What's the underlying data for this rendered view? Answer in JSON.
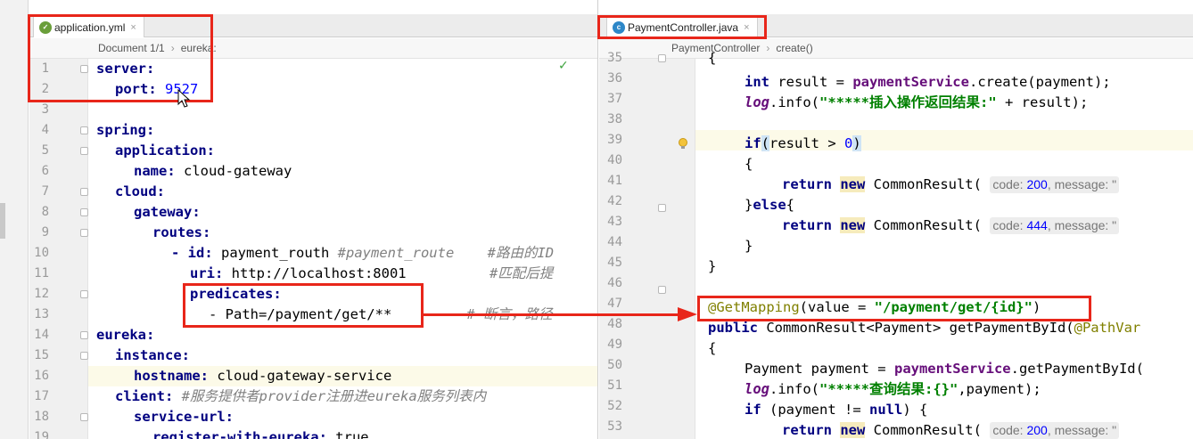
{
  "left_editor": {
    "tab_label": "application.yml",
    "tab_icon": "yaml-file-icon",
    "breadcrumb": [
      "Document 1/1",
      "eureka:"
    ],
    "lines": [
      {
        "n": "1",
        "indent": 0,
        "key": "server:",
        "val": "",
        "comment": ""
      },
      {
        "n": "2",
        "indent": 1,
        "key": "port:",
        "val": " 9527",
        "comment": ""
      },
      {
        "n": "3",
        "indent": 0,
        "key": "",
        "val": "",
        "comment": ""
      },
      {
        "n": "4",
        "indent": 0,
        "key": "spring:",
        "val": "",
        "comment": ""
      },
      {
        "n": "5",
        "indent": 1,
        "key": "application:",
        "val": "",
        "comment": ""
      },
      {
        "n": "6",
        "indent": 2,
        "key": "name:",
        "val": " cloud-gateway",
        "comment": ""
      },
      {
        "n": "7",
        "indent": 1,
        "key": "cloud:",
        "val": "",
        "comment": ""
      },
      {
        "n": "8",
        "indent": 2,
        "key": "gateway:",
        "val": "",
        "comment": ""
      },
      {
        "n": "9",
        "indent": 3,
        "key": "routes:",
        "val": "",
        "comment": ""
      },
      {
        "n": "10",
        "indent": 4,
        "key": "- id:",
        "val": " payment_routh ",
        "comment": "#payment_route    #路由的ID"
      },
      {
        "n": "11",
        "indent": 5,
        "key": "uri:",
        "val": " http://localhost:8001          ",
        "comment": "#匹配后提"
      },
      {
        "n": "12",
        "indent": 5,
        "key": "predicates:",
        "val": "",
        "comment": ""
      },
      {
        "n": "13",
        "indent": 6,
        "key": "",
        "val": "- Path=/payment/get/**",
        "comment": "         # 断言，路径"
      },
      {
        "n": "14",
        "indent": 0,
        "key": "eureka:",
        "val": "",
        "comment": ""
      },
      {
        "n": "15",
        "indent": 1,
        "key": "instance:",
        "val": "",
        "comment": ""
      },
      {
        "n": "16",
        "indent": 2,
        "key": "hostname:",
        "val": " cloud-gateway-service",
        "comment": ""
      },
      {
        "n": "17",
        "indent": 1,
        "key": "client:",
        "val": " ",
        "comment": "#服务提供者provider注册进eureka服务列表内"
      },
      {
        "n": "18",
        "indent": 2,
        "key": "service-url:",
        "val": "",
        "comment": ""
      },
      {
        "n": "19",
        "indent": 3,
        "key": "register-with-eureka:",
        "val": " true",
        "comment": ""
      }
    ]
  },
  "right_editor": {
    "tab_label": "PaymentController.java",
    "tab_icon": "java-class-icon",
    "breadcrumb": [
      "PaymentController",
      "create()"
    ],
    "line_numbers": [
      "35",
      "36",
      "37",
      "38",
      "39",
      "40",
      "41",
      "42",
      "43",
      "44",
      "45",
      "46",
      "47",
      "48",
      "49",
      "50",
      "51",
      "52",
      "53"
    ],
    "code": {
      "l35": "{",
      "l36_a": "int",
      "l36_b": " result = ",
      "l36_c": "paymentService",
      "l36_d": ".create(payment);",
      "l37_a": "log",
      "l37_b": ".info(",
      "l37_c": "\"*****插入操作返回结果:\"",
      "l37_d": " + result);",
      "l39_a": "if",
      "l39_b": "(",
      "l39_c": "result > ",
      "l39_d": "0",
      "l39_e": ")",
      "l40": "{",
      "l41_a": "return ",
      "l41_b": "new",
      "l41_c": " CommonResult( ",
      "l41_h1": "code: ",
      "l41_h1v": "200",
      "l41_sep": ", ",
      "l41_h2": "message: \"",
      "l42_a": "}",
      "l42_b": "else",
      "l42_c": "{",
      "l43_a": "return ",
      "l43_b": "new",
      "l43_c": " CommonResult( ",
      "l43_h1": "code: ",
      "l43_h1v": "444",
      "l43_sep": ", ",
      "l43_h2": "message: \"",
      "l44": "}",
      "l45": "}",
      "l47_a": "@GetMapping",
      "l47_b": "(value = ",
      "l47_c": "\"/payment/get/{id}\"",
      "l47_d": ")",
      "l48_a": "public",
      "l48_b": " CommonResult<Payment> getPaymentById(",
      "l48_c": "@PathVar",
      "l49": "{",
      "l50_a": "Payment payment = ",
      "l50_b": "paymentService",
      "l50_c": ".getPaymentById(",
      "l51_a": "log",
      "l51_b": ".info(",
      "l51_c": "\"*****查询结果:{}\"",
      "l51_d": ",payment);",
      "l52_a": "if",
      "l52_b": " (payment != ",
      "l52_c": "null",
      "l52_d": ") {",
      "l53_a": "return ",
      "l53_b": "new",
      "l53_c": " CommonResult( ",
      "l53_h1": "code: ",
      "l53_h1v": "200",
      "l53_sep": ", ",
      "l53_h2": "message: \""
    }
  },
  "colors": {
    "annotation_box": "#e8261a",
    "current_line": "#fcfae8",
    "yaml_key": "#000080",
    "string": "#008000",
    "comment": "#808080"
  }
}
